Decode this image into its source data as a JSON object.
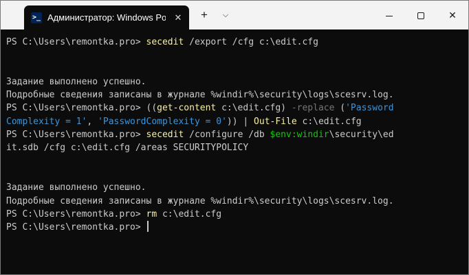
{
  "window": {
    "tab_title": "Администратор: Windows Po",
    "icon": "powershell-icon",
    "controls": [
      "close-tab-icon",
      "plus-icon",
      "chevron-down-icon",
      "minimize-icon",
      "maximize-icon",
      "close-icon"
    ]
  },
  "terminal": {
    "prompt": "PS C:\\Users\\remontka.pro> ",
    "l1": {
      "cmd": "secedit",
      "rest": " /export /cfg c:\\edit.cfg"
    },
    "msg_success": "Задание выполнено успешно.",
    "msg_log": "Подробные сведения записаны в журнале %windir%\\security\\logs\\scesrv.log.",
    "l2": {
      "open": "((",
      "cmd": "get-content",
      "arg": " c:\\edit.cfg) ",
      "param": "-replace",
      "sp": " (",
      "str1a": "'Password",
      "str1b": "Complexity = 1'",
      "comma": ", ",
      "str2": "'PasswordComplexity = 0'",
      "close": ")) | ",
      "cmd2": "Out-File",
      "arg2": " c:\\edit.cfg"
    },
    "l3": {
      "cmd": "secedit",
      "mid": " /configure /db ",
      "var": "$env:windir",
      "rest1": "\\security\\ed",
      "rest2": "it.sdb /cfg c:\\edit.cfg /areas SECURITYPOLICY"
    },
    "l4": {
      "cmd": "rm",
      "rest": " c:\\edit.cfg"
    }
  },
  "colors": {
    "background": "#0c0c0c",
    "text": "#cccccc",
    "command": "#f9f1a5",
    "string": "#3a96dd",
    "parameter": "#767676",
    "variable": "#16c60c"
  }
}
